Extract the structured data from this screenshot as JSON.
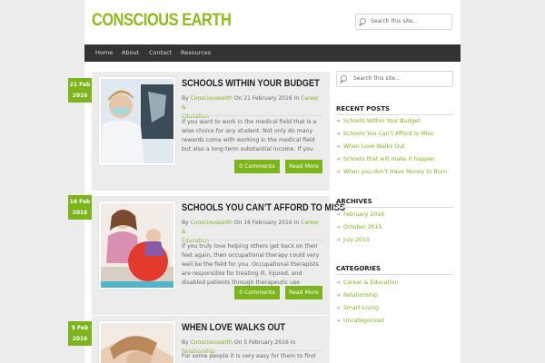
{
  "site": {
    "title": "CONSCIOUS EARTH",
    "search_placeholder": "Search this site..."
  },
  "nav": [
    "Home",
    "About",
    "Contact",
    "Resources"
  ],
  "posts": [
    {
      "date_day": "21 Feb",
      "date_year": "2016",
      "title": "SCHOOLS WITHIN YOUR BUDGET",
      "by": "By",
      "author": "Consciousearth",
      "on": "On",
      "date": "21 February 2016",
      "in": "In",
      "category": "Career &",
      "category2": "Education",
      "excerpt": "If you want to work in the medical field that is a wise choice for any student. Not only do many rewards come with working in the medical field but also a long-term substantial income. If you",
      "comments": "0 Comments",
      "read_more": "Read More"
    },
    {
      "date_day": "16 Feb",
      "date_year": "2016",
      "title": "SCHOOLS YOU CAN’T AFFORD TO MISS",
      "by": "By",
      "author": "Consciousearth",
      "on": "On",
      "date": "16 February 2016",
      "in": "In",
      "category": "Career &",
      "category2": "Education",
      "excerpt": "If you truly love helping others get back on their feet again, then occupational therapy could very well be the field for you. Occupational therapists are responsible for treating ill, injured, and disabled patients through therapeutic use",
      "comments": "0 Comments",
      "read_more": "Read More"
    },
    {
      "date_day": "5 Feb",
      "date_year": "2016",
      "title": "WHEN LOVE WALKS OUT",
      "by": "By",
      "author": "Consciousearth",
      "on": "On",
      "date": "5 February 2016",
      "in": "In",
      "category": "Relationship",
      "category2": "",
      "excerpt": "For some people it is very easy for them to find",
      "comments": "",
      "read_more": ""
    }
  ],
  "sidebar": {
    "search_placeholder": "Search this site...",
    "recent_posts": {
      "title": "RECENT POSTS",
      "items": [
        "Schools Within Your Budget",
        "Schools You Can’t Afford to Miss",
        "When Love Walks Out",
        "Schools that will make it happen",
        "When you don’t Have Money to Burn"
      ]
    },
    "archives": {
      "title": "ARCHIVES",
      "items": [
        "February 2016",
        "October 2015",
        "July 2015"
      ]
    },
    "categories": {
      "title": "CATEGORIES",
      "items": [
        "Career & Education",
        "Relationship",
        "Smart Living",
        "Uncategorized"
      ]
    }
  },
  "colors": {
    "accent": "#7cb51b",
    "title_green": "#8cbb1b",
    "nav_bg": "#333333"
  }
}
